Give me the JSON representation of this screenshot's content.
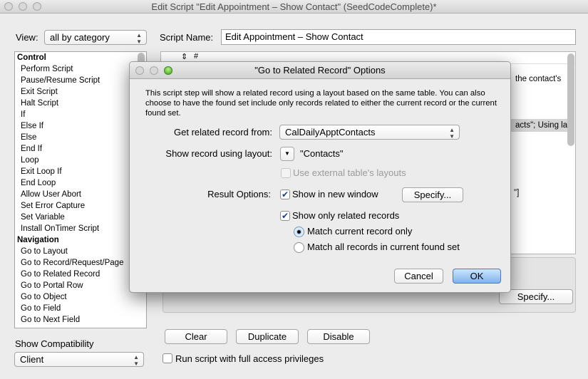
{
  "window": {
    "title": "Edit Script \"Edit Appointment – Show Contact\" (SeedCodeComplete)*"
  },
  "view": {
    "label": "View:",
    "value": "all by category"
  },
  "script_name": {
    "label": "Script Name:",
    "value": "Edit Appointment – Show Contact"
  },
  "steps": [
    {
      "label": "Control",
      "header": true
    },
    {
      "label": "Perform Script"
    },
    {
      "label": "Pause/Resume Script"
    },
    {
      "label": "Exit Script"
    },
    {
      "label": "Halt Script"
    },
    {
      "label": "If"
    },
    {
      "label": "Else If"
    },
    {
      "label": "Else"
    },
    {
      "label": "End If"
    },
    {
      "label": "Loop"
    },
    {
      "label": "Exit Loop If"
    },
    {
      "label": "End Loop"
    },
    {
      "label": "Allow User Abort"
    },
    {
      "label": "Set Error Capture"
    },
    {
      "label": "Set Variable"
    },
    {
      "label": "Install OnTimer Script"
    },
    {
      "label": "Navigation",
      "header": true
    },
    {
      "label": "Go to Layout"
    },
    {
      "label": "Go to Record/Request/Page"
    },
    {
      "label": "Go to Related Record"
    },
    {
      "label": "Go to Portal Row"
    },
    {
      "label": "Go to Object"
    },
    {
      "label": "Go to Field"
    },
    {
      "label": "Go to Next Field"
    }
  ],
  "script_area": {
    "header": "#",
    "fragments": [
      "the contact's",
      "acts\"; Using la",
      "\"]"
    ]
  },
  "specify_bg": "Specify...",
  "bottom": {
    "clear": "Clear",
    "duplicate": "Duplicate",
    "disable": "Disable",
    "compat_label": "Show Compatibility",
    "compat_value": "Client",
    "full_access": "Run script with full access privileges",
    "full_access_checked": false
  },
  "dialog": {
    "title": "\"Go to Related Record\" Options",
    "description": "This script step will show a related record using a layout based on the same table.  You can also choose to have the found set include only records related to either the current record or the current found set.",
    "get_from_label": "Get related record from:",
    "get_from_value": "CalDailyApptContacts",
    "layout_label": "Show record using layout:",
    "layout_value": "\"Contacts\"",
    "external_label": "Use external table's layouts",
    "external_checked": false,
    "result_label": "Result Options:",
    "new_window_label": "Show in new window",
    "new_window_checked": true,
    "specify": "Specify...",
    "only_related_label": "Show only related records",
    "only_related_checked": true,
    "match_current": "Match current record only",
    "match_all": "Match all records in current found set",
    "selected_match": "current",
    "cancel": "Cancel",
    "ok": "OK"
  }
}
